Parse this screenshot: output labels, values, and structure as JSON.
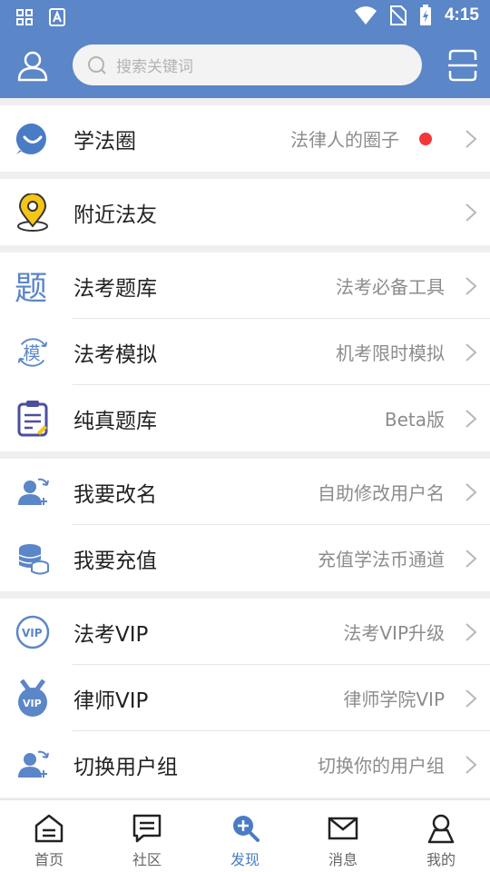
{
  "status_bar": {
    "time": "4:15"
  },
  "header": {
    "search_placeholder": "搜索关键词"
  },
  "groups": [
    [
      {
        "icon": "chat-bubble-icon",
        "title": "学法圈",
        "subtitle": "法律人的圈子",
        "badge": "red-dot"
      }
    ],
    [
      {
        "icon": "location-pin-icon",
        "title": "附近法友",
        "subtitle": ""
      }
    ],
    [
      {
        "icon": "question-bank-icon",
        "title": "法考题库",
        "subtitle": "法考必备工具"
      },
      {
        "icon": "mock-exam-icon",
        "title": "法考模拟",
        "subtitle": "机考限时模拟"
      },
      {
        "icon": "clipboard-icon",
        "title": "纯真题库",
        "subtitle": "Beta版"
      }
    ],
    [
      {
        "icon": "rename-user-icon",
        "title": "我要改名",
        "subtitle": "自助修改用户名"
      },
      {
        "icon": "coins-icon",
        "title": "我要充值",
        "subtitle": "充值学法币通道"
      }
    ],
    [
      {
        "icon": "vip-badge-icon",
        "title": "法考VIP",
        "subtitle": "法考VIP升级"
      },
      {
        "icon": "medal-vip-icon",
        "title": "律师VIP",
        "subtitle": "律师学院VIP"
      },
      {
        "icon": "switch-group-icon",
        "title": "切换用户组",
        "subtitle": "切换你的用户组"
      }
    ]
  ],
  "bottom_nav": [
    {
      "label": "首页",
      "icon": "home-icon",
      "active": false
    },
    {
      "label": "社区",
      "icon": "community-icon",
      "active": false
    },
    {
      "label": "发现",
      "icon": "discover-icon",
      "active": true
    },
    {
      "label": "消息",
      "icon": "mail-icon",
      "active": false
    },
    {
      "label": "我的",
      "icon": "profile-icon",
      "active": false
    }
  ],
  "colors": {
    "primary": "#5b86c8",
    "accent_blue": "#4a7bc5",
    "badge_red": "#f2383a",
    "pin_yellow": "#f5c518"
  }
}
